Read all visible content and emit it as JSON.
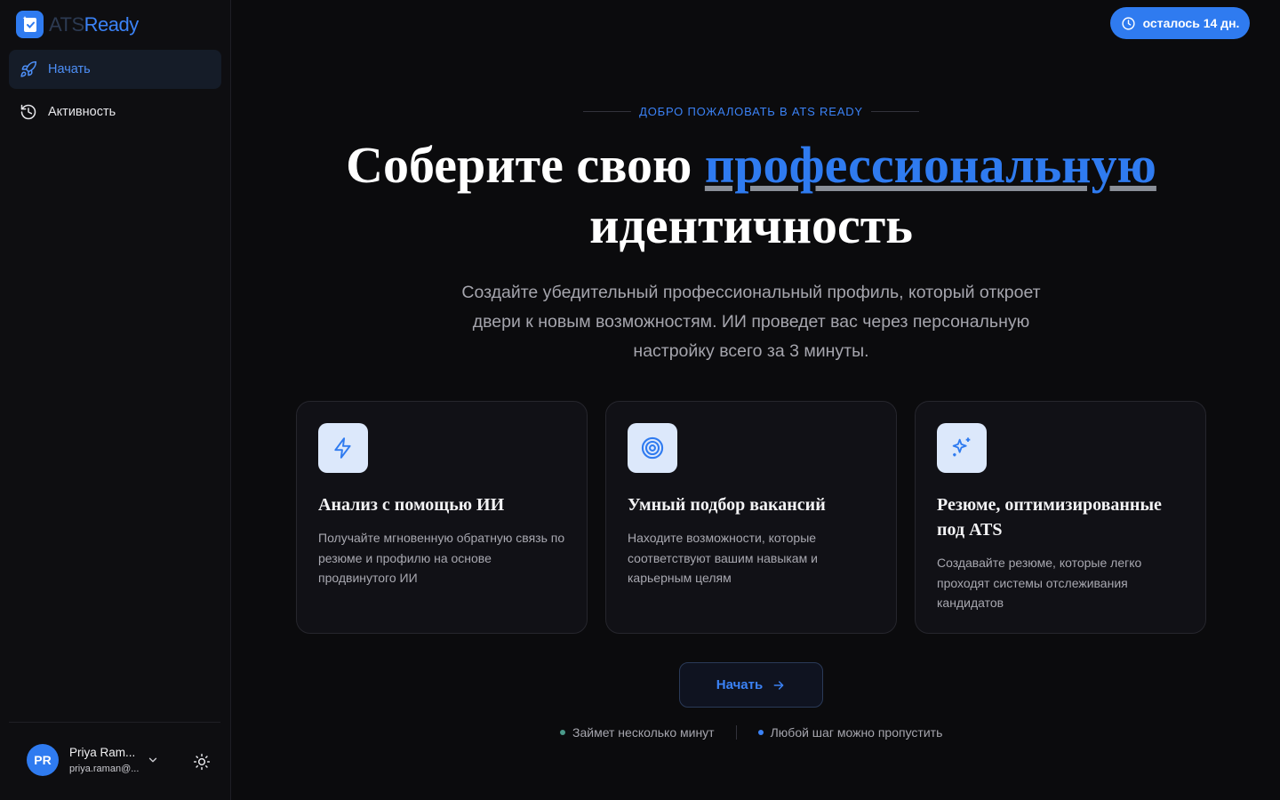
{
  "brand": {
    "name_part1": "ATS",
    "name_part2": "Ready"
  },
  "sidebar": {
    "items": [
      {
        "label": "Начать",
        "icon": "rocket-icon",
        "active": true
      },
      {
        "label": "Активность",
        "icon": "history-icon",
        "active": false
      }
    ]
  },
  "user": {
    "initials": "PR",
    "name": "Priya Ram...",
    "email": "priya.raman@..."
  },
  "trial": {
    "label": "осталось 14 дн.",
    "icon": "clock-icon"
  },
  "hero": {
    "eyebrow": "ДОБРО ПОЖАЛОВАТЬ В ATS READY",
    "title_part1": "Соберите свою ",
    "title_accent": "профессиональную",
    "title_part2": "идентичность",
    "subtitle": "Создайте убедительный профессиональный профиль, который откроет двери к новым возможностям. ИИ проведет вас через персональную настройку всего за 3 минуты."
  },
  "cards": [
    {
      "icon": "lightning-icon",
      "title": "Анализ с помощью ИИ",
      "desc": "Получайте мгновенную обратную связь по резюме и профилю на основе продвинутого ИИ"
    },
    {
      "icon": "target-icon",
      "title": "Умный подбор вакансий",
      "desc": "Находите возможности, которые соответствуют вашим навыкам и карьерным целям"
    },
    {
      "icon": "sparkles-icon",
      "title": "Резюме, оптимизированные под ATS",
      "desc": "Создавайте резюме, которые легко проходят системы отслеживания кандидатов"
    }
  ],
  "cta": {
    "label": "Начать",
    "icon": "arrow-right-icon"
  },
  "hints": [
    {
      "label": "Займет несколько минут",
      "dot_color": "#4a9a8a"
    },
    {
      "label": "Любой шаг можно пропустить",
      "dot_color": "#3b82f6"
    }
  ],
  "colors": {
    "accent": "#2f7bf0",
    "background": "#0b0b0d",
    "sidebar": "#0e0e11"
  }
}
